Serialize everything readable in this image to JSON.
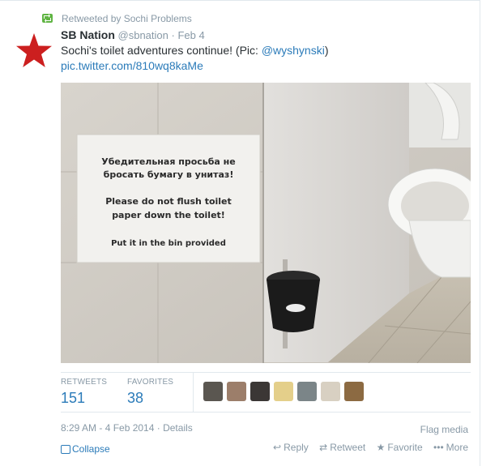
{
  "retweet_context": {
    "text": "Retweeted by Sochi Problems"
  },
  "tweet": {
    "author_name": "SB Nation",
    "author_handle": "@sbnation",
    "separator": "·",
    "date": "Feb 4",
    "text_before_mention": "Sochi's toilet adventures continue! (Pic: ",
    "mention": "@wyshynski",
    "text_after_mention": ")",
    "pic_link": "pic.twitter.com/810wq8kaMe",
    "photo_sign": {
      "ru_line1": "Убедительная просьба не",
      "ru_line2": "бросать бумагу в унитаз!",
      "en_line1": "Please do not flush toilet",
      "en_line2": "paper down the toilet!",
      "en_line3": "Put it in the bin provided"
    }
  },
  "stats": {
    "retweets_label": "RETWEETS",
    "retweets_count": "151",
    "favorites_label": "FAVORITES",
    "favorites_count": "38"
  },
  "meta": {
    "timestamp": "8:29 AM - 4 Feb 2014",
    "separator": "·",
    "details_label": "Details",
    "flag_label": "Flag media"
  },
  "actions": {
    "collapse_label": "Collapse",
    "reply_label": "Reply",
    "retweet_label": "Retweet",
    "favorite_label": "Favorite",
    "more_label": "More"
  },
  "colors": {
    "link": "#2b7bb9",
    "muted": "#8899a6",
    "retweet_green": "#5fb442",
    "avatar_star": "#cc1f1f"
  },
  "icons": [
    "retweet-icon",
    "star-avatar-icon",
    "collapse-icon",
    "reply-icon",
    "retweet-action-icon",
    "favorite-icon",
    "more-icon"
  ]
}
